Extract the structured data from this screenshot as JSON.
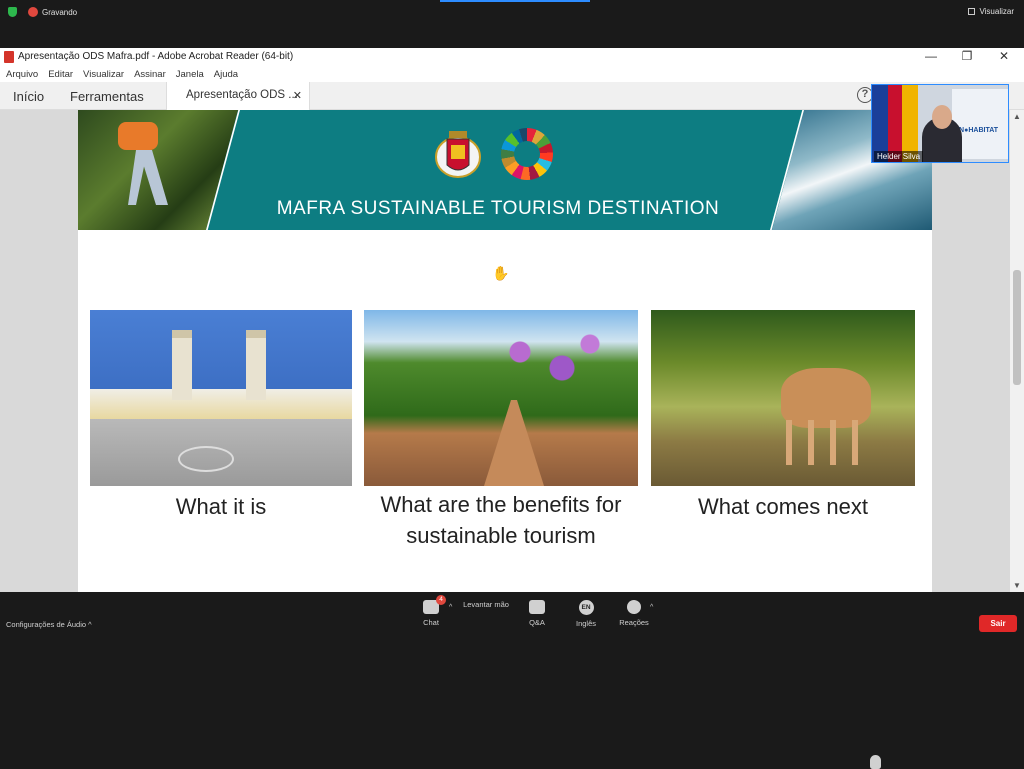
{
  "zoom_top": {
    "recording_label": "Gravando",
    "view_label": "Visualizar"
  },
  "acrobat": {
    "window_title": "Apresentação ODS Mafra.pdf - Adobe Acrobat Reader (64-bit)",
    "window_controls": {
      "minimize": "—",
      "maximize": "❐",
      "close": "✕"
    },
    "menu": [
      "Arquivo",
      "Editar",
      "Visualizar",
      "Assinar",
      "Janela",
      "Ajuda"
    ],
    "tabs": {
      "home": "Início",
      "tools": "Ferramentas",
      "document": "Apresentação ODS ...",
      "close": "✕"
    },
    "help": "?"
  },
  "slide": {
    "banner_title": "MAFRA SUSTAINABLE TOURISM DESTINATION",
    "captions": {
      "c1": "What it is",
      "c2": "What are the benefits for sustainable tourism",
      "c3": "What comes next"
    }
  },
  "self_view": {
    "name": "Helder Silva",
    "banner_text": "UN●HABITAT"
  },
  "zoom_bottom": {
    "audio_config": "Configurações de Áudio",
    "chat": "Chat",
    "chat_badge": "4",
    "raise_hand": "Levantar mão",
    "qa": "Q&A",
    "language": "Inglês",
    "language_code": "EN",
    "reactions": "Reações",
    "leave": "Sair"
  },
  "colors": {
    "banner_teal": "#0d7d82",
    "leave_red": "#e02828",
    "record_red": "#e0483e",
    "zoom_blue": "#2d8cff"
  }
}
